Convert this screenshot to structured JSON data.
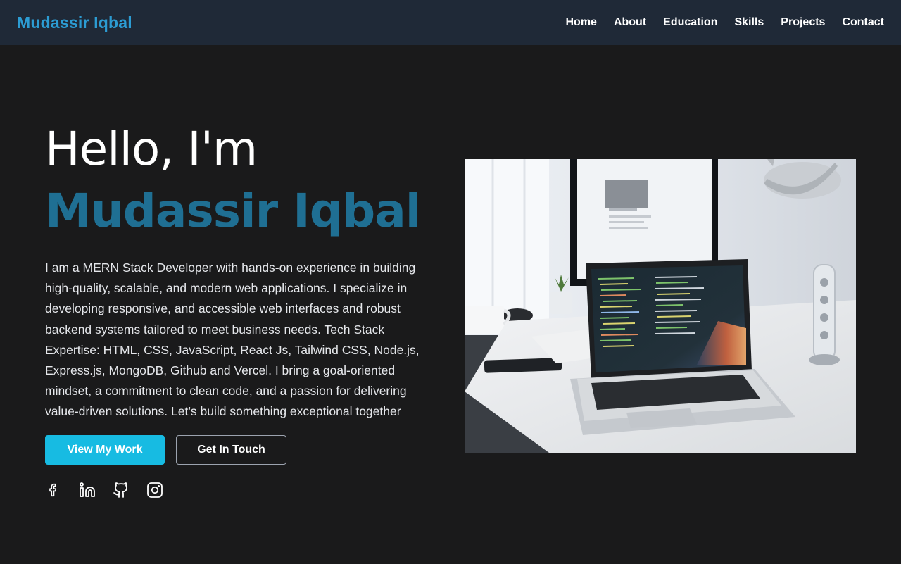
{
  "navbar": {
    "brand": "Mudassir Iqbal",
    "links": [
      "Home",
      "About",
      "Education",
      "Skills",
      "Projects",
      "Contact"
    ]
  },
  "hero": {
    "greeting": "Hello, I'm",
    "name": "Mudassir Iqbal",
    "bio": "I am a MERN Stack Developer with hands-on experience in building high-quality, scalable, and modern web applications. I specialize in developing responsive, and accessible web interfaces and robust backend systems tailored to meet business needs. Tech Stack Expertise: HTML, CSS, JavaScript, React Js, Tailwind CSS, Node.js, Express.js, MongoDB, Github and Vercel. I bring a goal-oriented mindset, a commitment to clean code, and a passion for delivering value-driven solutions. Let’s build something exceptional together",
    "primary_button": "View My Work",
    "secondary_button": "Get In Touch"
  },
  "socials": [
    "facebook-icon",
    "linkedin-icon",
    "github-icon",
    "instagram-icon"
  ],
  "colors": {
    "background": "#1a1a1b",
    "navbar": "#1f2937",
    "brand": "#2c9cd3",
    "name": "#1f6f93",
    "primary_button": "#17bbe2"
  }
}
